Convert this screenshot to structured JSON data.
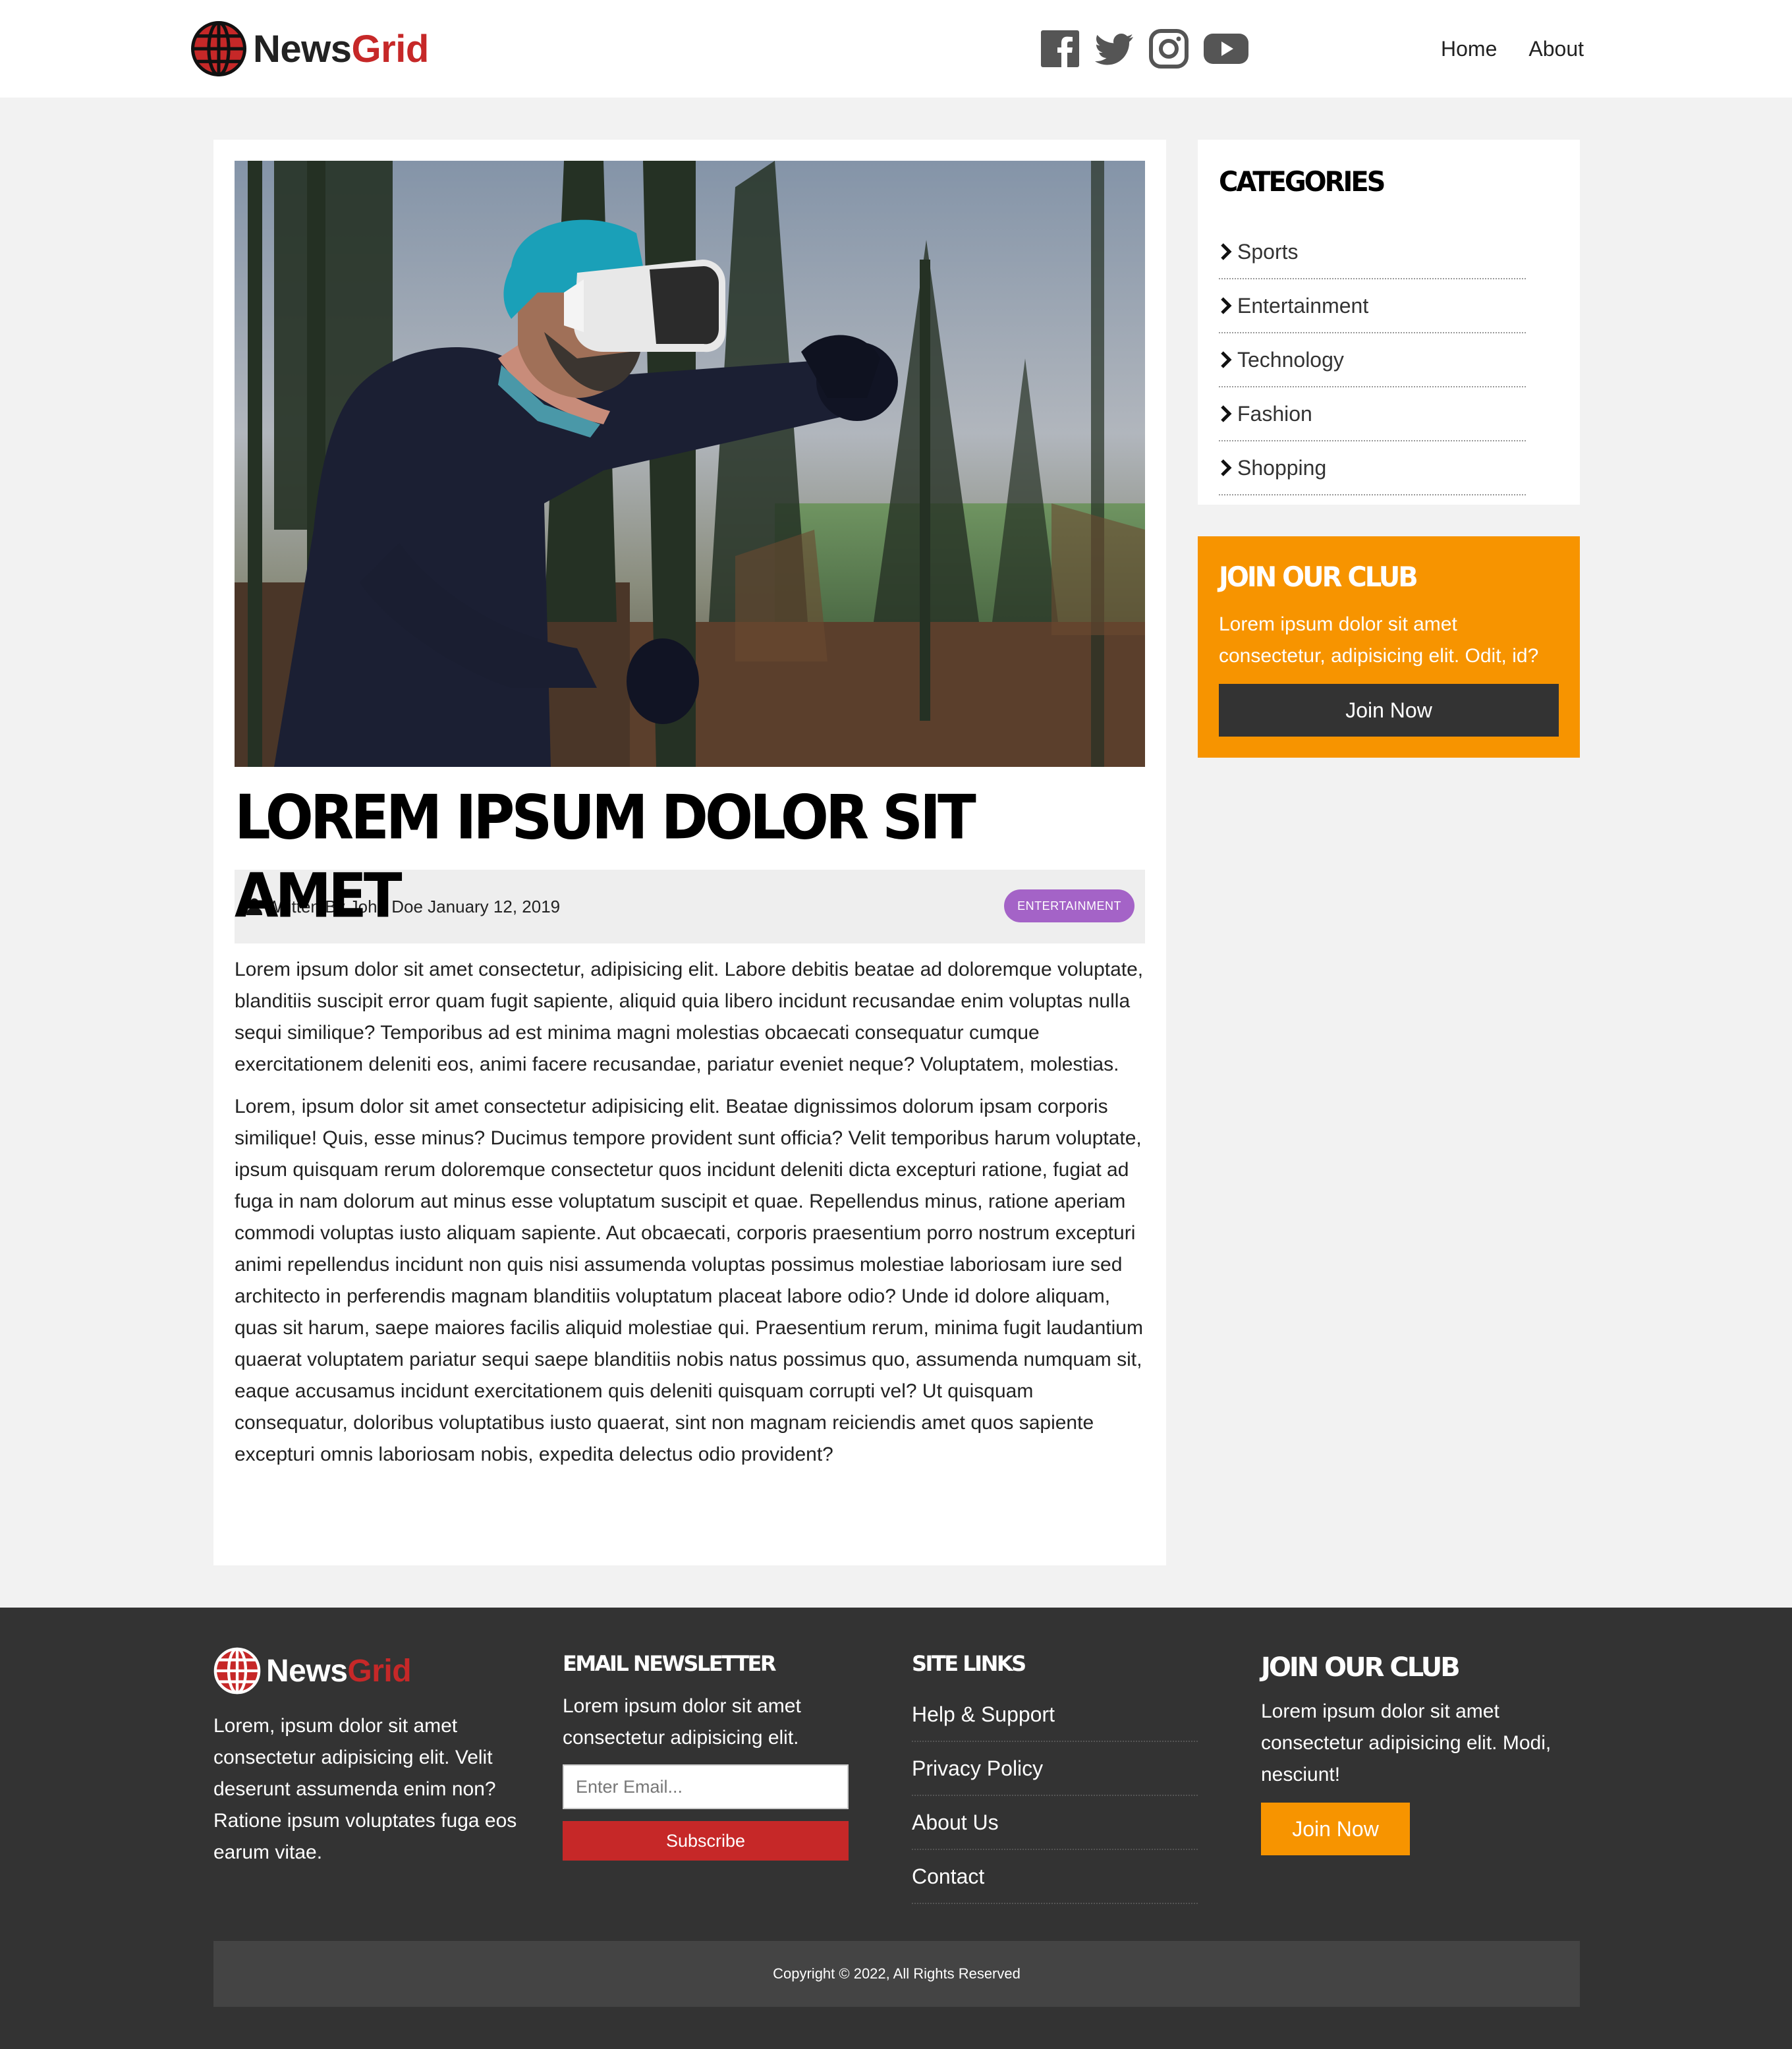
{
  "brand": {
    "name_part1": "News",
    "name_part2": "Grid",
    "primary_color": "#c62828",
    "accent_color": "#f79400"
  },
  "navbar": {
    "social_icons": [
      "facebook-icon",
      "twitter-icon",
      "instagram-icon",
      "youtube-icon"
    ],
    "links": [
      {
        "label": "Home"
      },
      {
        "label": "About"
      }
    ]
  },
  "article": {
    "image_alt": "Man wearing a VR headset punching in a forest",
    "title": "LOREM IPSUM DOLOR SIT AMET",
    "meta": "Written By John Doe January 12, 2019",
    "category_badge": "ENTERTAINMENT",
    "paragraphs": [
      "Lorem ipsum dolor sit amet consectetur, adipisicing elit. Labore debitis beatae ad doloremque voluptate, blanditiis suscipit error quam fugit sapiente, aliquid quia libero incidunt recusandae enim voluptas nulla sequi similique? Temporibus ad est minima magni molestias obcaecati consequatur cumque exercitationem deleniti eos, animi facere recusandae, pariatur eveniet neque? Voluptatem, molestias.",
      "Lorem, ipsum dolor sit amet consectetur adipisicing elit. Beatae dignissimos dolorum ipsam corporis similique! Quis, esse minus? Ducimus tempore provident sunt officia? Velit temporibus harum voluptate, ipsum quisquam rerum doloremque consectetur quos incidunt deleniti dicta excepturi ratione, fugiat ad fuga in nam dolorum aut minus esse voluptatum suscipit et quae. Repellendus minus, ratione aperiam commodi voluptas iusto aliquam sapiente. Aut obcaecati, corporis praesentium porro nostrum excepturi animi repellendus incidunt non quis nisi assumenda voluptas possimus molestiae laboriosam iure sed architecto in perferendis magnam blanditiis voluptatum placeat labore odio? Unde id dolore aliquam, quas sit harum, saepe maiores facilis aliquid molestiae qui. Praesentium rerum, minima fugit laudantium quaerat voluptatem pariatur sequi saepe blanditiis nobis natus possimus quo, assumenda numquam sit, eaque accusamus incidunt exercitationem quis deleniti quisquam corrupti vel? Ut quisquam consequatur, doloribus voluptatibus iusto quaerat, sint non magnam reiciendis amet quos sapiente excepturi omnis laboriosam nobis, expedita delectus odio provident?"
    ]
  },
  "sidebar": {
    "categories_heading": "CATEGORIES",
    "categories": [
      "Sports",
      "Entertainment",
      "Technology",
      "Fashion",
      "Shopping"
    ],
    "club": {
      "heading": "JOIN OUR CLUB",
      "text": "Lorem ipsum dolor sit amet consectetur, adipisicing elit. Odit, id?",
      "button": "Join Now"
    }
  },
  "footer": {
    "about_text": "Lorem, ipsum dolor sit amet consectetur adipisicing elit. Velit deserunt assumenda enim non? Ratione ipsum voluptates fuga eos earum vitae.",
    "newsletter": {
      "heading": "EMAIL NEWSLETTER",
      "text": "Lorem ipsum dolor sit amet consectetur adipisicing elit.",
      "placeholder": "Enter Email...",
      "button": "Subscribe"
    },
    "site_links": {
      "heading": "SITE LINKS",
      "items": [
        "Help & Support",
        "Privacy Policy",
        "About Us",
        "Contact"
      ]
    },
    "club": {
      "heading": "JOIN OUR CLUB",
      "text": "Lorem ipsum dolor sit amet consectetur adipisicing elit. Modi, nesciunt!",
      "button": "Join Now"
    },
    "copyright": "Copyright © 2022, All Rights Reserved"
  }
}
